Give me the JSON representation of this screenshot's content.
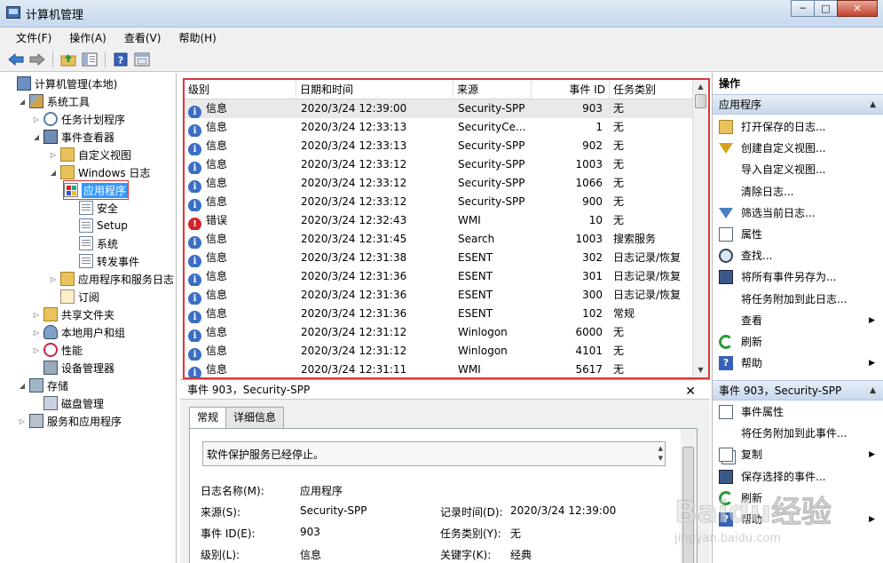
{
  "window": {
    "title": "计算机管理",
    "minimize": "─",
    "maximize": "□",
    "close": "✕"
  },
  "menu": [
    "文件(F)",
    "操作(A)",
    "查看(V)",
    "帮助(H)"
  ],
  "toolbar": [
    "back-icon",
    "forward-icon",
    "up-folder-icon",
    "show-hide-tree-icon",
    "help-icon",
    "properties-icon"
  ],
  "tree": [
    {
      "label": "计算机管理(本地)",
      "icon": "computer-icon",
      "expander": ""
    },
    {
      "label": "系统工具",
      "icon": "tools-icon",
      "expander": "◢"
    },
    {
      "label": "任务计划程序",
      "icon": "clock-icon",
      "expander": "▷"
    },
    {
      "label": "事件查看器",
      "icon": "event-viewer-icon",
      "expander": "◢"
    },
    {
      "label": "自定义视图",
      "icon": "folder-icon",
      "expander": "▷"
    },
    {
      "label": "Windows 日志",
      "icon": "folder-icon",
      "expander": "◢"
    },
    {
      "label": "应用程序",
      "icon": "application-log-icon",
      "expander": ""
    },
    {
      "label": "安全",
      "icon": "log-icon",
      "expander": ""
    },
    {
      "label": "Setup",
      "icon": "log-icon",
      "expander": ""
    },
    {
      "label": "系统",
      "icon": "log-icon",
      "expander": ""
    },
    {
      "label": "转发事件",
      "icon": "log-icon",
      "expander": ""
    },
    {
      "label": "应用程序和服务日志",
      "icon": "folder-icon",
      "expander": "▷"
    },
    {
      "label": "订阅",
      "icon": "subscription-icon",
      "expander": ""
    },
    {
      "label": "共享文件夹",
      "icon": "shared-folder-icon",
      "expander": "▷"
    },
    {
      "label": "本地用户和组",
      "icon": "users-icon",
      "expander": "▷"
    },
    {
      "label": "性能",
      "icon": "performance-icon",
      "expander": "▷"
    },
    {
      "label": "设备管理器",
      "icon": "device-manager-icon",
      "expander": ""
    },
    {
      "label": "存储",
      "icon": "storage-icon",
      "expander": "◢"
    },
    {
      "label": "磁盘管理",
      "icon": "disk-icon",
      "expander": ""
    },
    {
      "label": "服务和应用程序",
      "icon": "services-icon",
      "expander": "▷"
    }
  ],
  "events": {
    "columns": [
      "级别",
      "日期和时间",
      "来源",
      "事件 ID",
      "任务类别"
    ],
    "rows": [
      {
        "level": "信息",
        "type": "info",
        "datetime": "2020/3/24 12:39:00",
        "source": "Security-SPP",
        "id": "903",
        "category": "无"
      },
      {
        "level": "信息",
        "type": "info",
        "datetime": "2020/3/24 12:33:13",
        "source": "SecurityCe...",
        "id": "1",
        "category": "无"
      },
      {
        "level": "信息",
        "type": "info",
        "datetime": "2020/3/24 12:33:13",
        "source": "Security-SPP",
        "id": "902",
        "category": "无"
      },
      {
        "level": "信息",
        "type": "info",
        "datetime": "2020/3/24 12:33:12",
        "source": "Security-SPP",
        "id": "1003",
        "category": "无"
      },
      {
        "level": "信息",
        "type": "info",
        "datetime": "2020/3/24 12:33:12",
        "source": "Security-SPP",
        "id": "1066",
        "category": "无"
      },
      {
        "level": "信息",
        "type": "info",
        "datetime": "2020/3/24 12:33:12",
        "source": "Security-SPP",
        "id": "900",
        "category": "无"
      },
      {
        "level": "错误",
        "type": "error",
        "datetime": "2020/3/24 12:32:43",
        "source": "WMI",
        "id": "10",
        "category": "无"
      },
      {
        "level": "信息",
        "type": "info",
        "datetime": "2020/3/24 12:31:45",
        "source": "Search",
        "id": "1003",
        "category": "搜索服务"
      },
      {
        "level": "信息",
        "type": "info",
        "datetime": "2020/3/24 12:31:38",
        "source": "ESENT",
        "id": "302",
        "category": "日志记录/恢复"
      },
      {
        "level": "信息",
        "type": "info",
        "datetime": "2020/3/24 12:31:36",
        "source": "ESENT",
        "id": "301",
        "category": "日志记录/恢复"
      },
      {
        "level": "信息",
        "type": "info",
        "datetime": "2020/3/24 12:31:36",
        "source": "ESENT",
        "id": "300",
        "category": "日志记录/恢复"
      },
      {
        "level": "信息",
        "type": "info",
        "datetime": "2020/3/24 12:31:36",
        "source": "ESENT",
        "id": "102",
        "category": "常规"
      },
      {
        "level": "信息",
        "type": "info",
        "datetime": "2020/3/24 12:31:12",
        "source": "Winlogon",
        "id": "6000",
        "category": "无"
      },
      {
        "level": "信息",
        "type": "info",
        "datetime": "2020/3/24 12:31:12",
        "source": "Winlogon",
        "id": "4101",
        "category": "无"
      },
      {
        "level": "信息",
        "type": "info",
        "datetime": "2020/3/24 12:31:11",
        "source": "WMI",
        "id": "5617",
        "category": "无"
      }
    ]
  },
  "detail": {
    "header": "事件 903，Security-SPP",
    "tabs": [
      "常规",
      "详细信息"
    ],
    "message": "软件保护服务已经停止。",
    "fields": [
      {
        "label": "日志名称(M):",
        "value": "应用程序"
      },
      {
        "label": "来源(S):",
        "value": "Security-SPP"
      },
      {
        "label": "事件 ID(E):",
        "value": "903"
      },
      {
        "label": "级别(L):",
        "value": "信息"
      }
    ],
    "fields_right": [
      {
        "label": "记录时间(D):",
        "value": "2020/3/24 12:39:00"
      },
      {
        "label": "任务类别(Y):",
        "value": "无"
      },
      {
        "label": "关键字(K):",
        "value": "经典"
      }
    ]
  },
  "actions": {
    "title": "操作",
    "section1": "应用程序",
    "items1": [
      {
        "label": "打开保存的日志...",
        "icon": "open-log-icon"
      },
      {
        "label": "创建自定义视图...",
        "icon": "filter-icon"
      },
      {
        "label": "导入自定义视图...",
        "icon": ""
      },
      {
        "label": "清除日志...",
        "icon": ""
      },
      {
        "label": "筛选当前日志...",
        "icon": "filter-icon"
      },
      {
        "label": "属性",
        "icon": "properties-icon"
      },
      {
        "label": "查找...",
        "icon": "find-icon"
      },
      {
        "label": "将所有事件另存为...",
        "icon": "save-icon"
      },
      {
        "label": "将任务附加到此日志...",
        "icon": ""
      },
      {
        "label": "查看",
        "icon": "",
        "submenu": true
      },
      {
        "label": "刷新",
        "icon": "refresh-icon"
      },
      {
        "label": "帮助",
        "icon": "help-icon",
        "submenu": true
      }
    ],
    "section2": "事件 903，Security-SPP",
    "items2": [
      {
        "label": "事件属性",
        "icon": "properties-icon"
      },
      {
        "label": "将任务附加到此事件...",
        "icon": ""
      },
      {
        "label": "复制",
        "icon": "copy-icon",
        "submenu": true
      },
      {
        "label": "保存选择的事件...",
        "icon": "save-icon"
      },
      {
        "label": "刷新",
        "icon": "refresh-icon"
      },
      {
        "label": "帮助",
        "icon": "help-icon",
        "submenu": true
      }
    ]
  },
  "watermark": {
    "text": "Baidu经验",
    "url": "jingyan.baidu.com"
  }
}
